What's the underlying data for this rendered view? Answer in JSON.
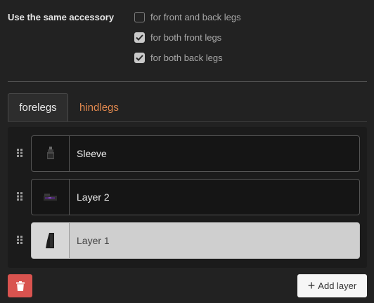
{
  "options": {
    "label": "Use the same accessory",
    "checkboxes": [
      {
        "label": "for front and back legs",
        "checked": false
      },
      {
        "label": "for both front legs",
        "checked": true
      },
      {
        "label": "for both back legs",
        "checked": true
      }
    ]
  },
  "tabs": [
    {
      "label": "forelegs",
      "active": true
    },
    {
      "label": "hindlegs",
      "active": false
    }
  ],
  "layers": [
    {
      "name": "Sleeve",
      "selected": false,
      "thumbnail": "sleeve-sprite"
    },
    {
      "name": "Layer 2",
      "selected": false,
      "thumbnail": "hoof-sprite"
    },
    {
      "name": "Layer 1",
      "selected": true,
      "thumbnail": "leg-sprite"
    }
  ],
  "actions": {
    "delete_icon": "trash-icon",
    "add_label": "Add layer",
    "add_icon": "plus-icon"
  },
  "colors": {
    "background": "#222222",
    "accent_tab": "#e0884e",
    "delete": "#d9534f"
  }
}
